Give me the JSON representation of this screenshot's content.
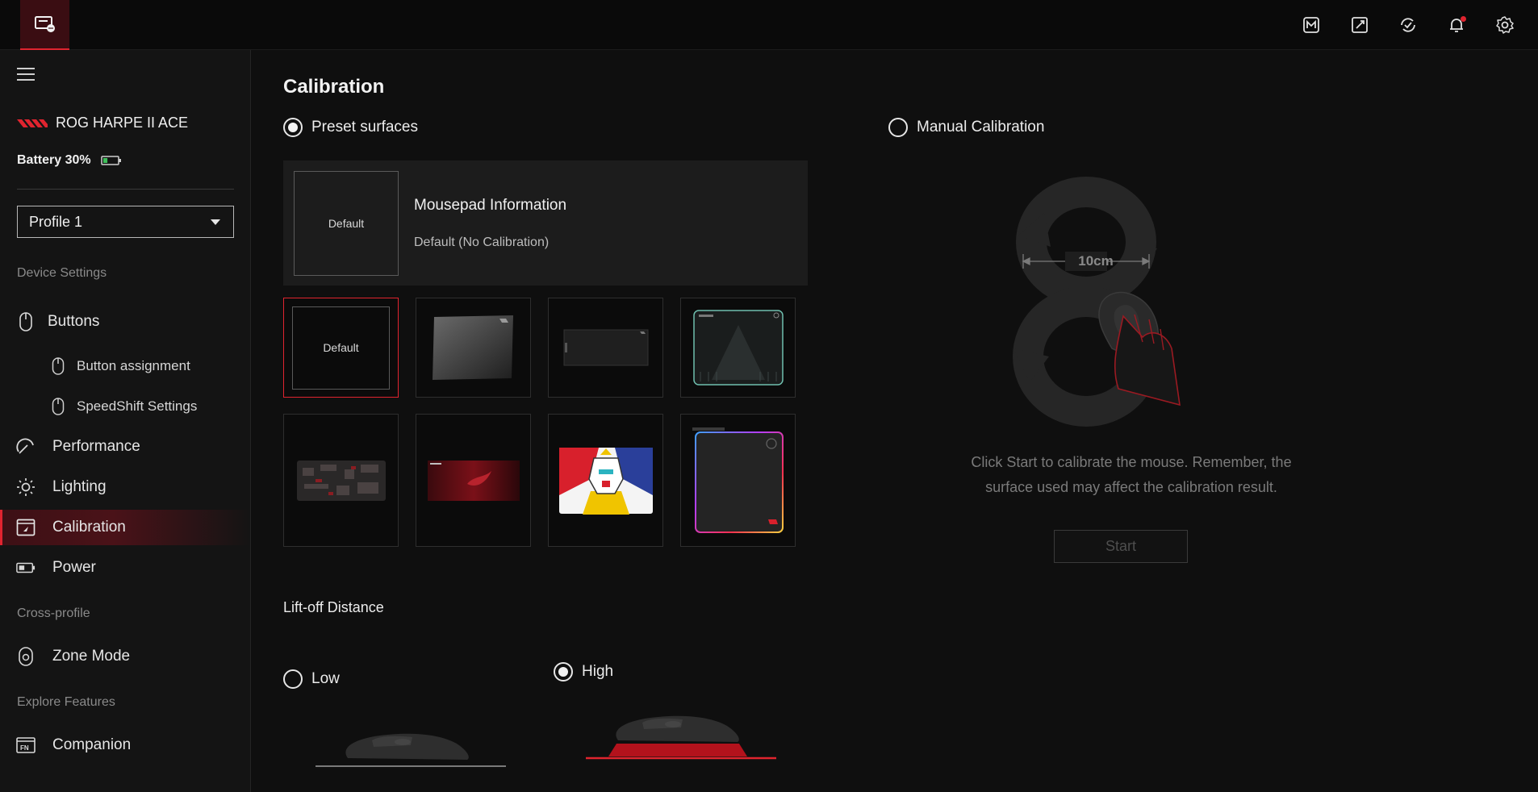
{
  "topbar": {
    "icons": [
      "armoury-mode-icon",
      "tools-icon",
      "update-icon",
      "notification-icon",
      "settings-icon"
    ],
    "accent": "#e0242f"
  },
  "sidebar": {
    "device_name": "ROG HARPE II ACE",
    "battery_label": "Battery 30%",
    "battery_level": 0.3,
    "profile": "Profile 1",
    "sections": {
      "device_settings": "Device Settings",
      "cross_profile": "Cross-profile",
      "explore_features": "Explore Features"
    },
    "items": {
      "buttons": "Buttons",
      "button_assignment": "Button assignment",
      "speedshift": "SpeedShift Settings",
      "performance": "Performance",
      "lighting": "Lighting",
      "calibration": "Calibration",
      "power": "Power",
      "zone_mode": "Zone Mode",
      "companion": "Companion"
    }
  },
  "main": {
    "title": "Calibration",
    "preset_label": "Preset surfaces",
    "manual_label": "Manual Calibration",
    "info": {
      "thumb_label": "Default",
      "title": "Mousepad Information",
      "subtitle": "Default (No Calibration)"
    },
    "pads": {
      "default_label": "Default"
    },
    "liftoff": {
      "title": "Lift-off Distance",
      "low": "Low",
      "high": "High",
      "selected": "High"
    },
    "manual": {
      "distance_label": "10cm",
      "instructions_line1": "Click Start to calibrate the mouse. Remember, the",
      "instructions_line2": "surface used may affect the calibration result.",
      "start_label": "Start"
    }
  }
}
